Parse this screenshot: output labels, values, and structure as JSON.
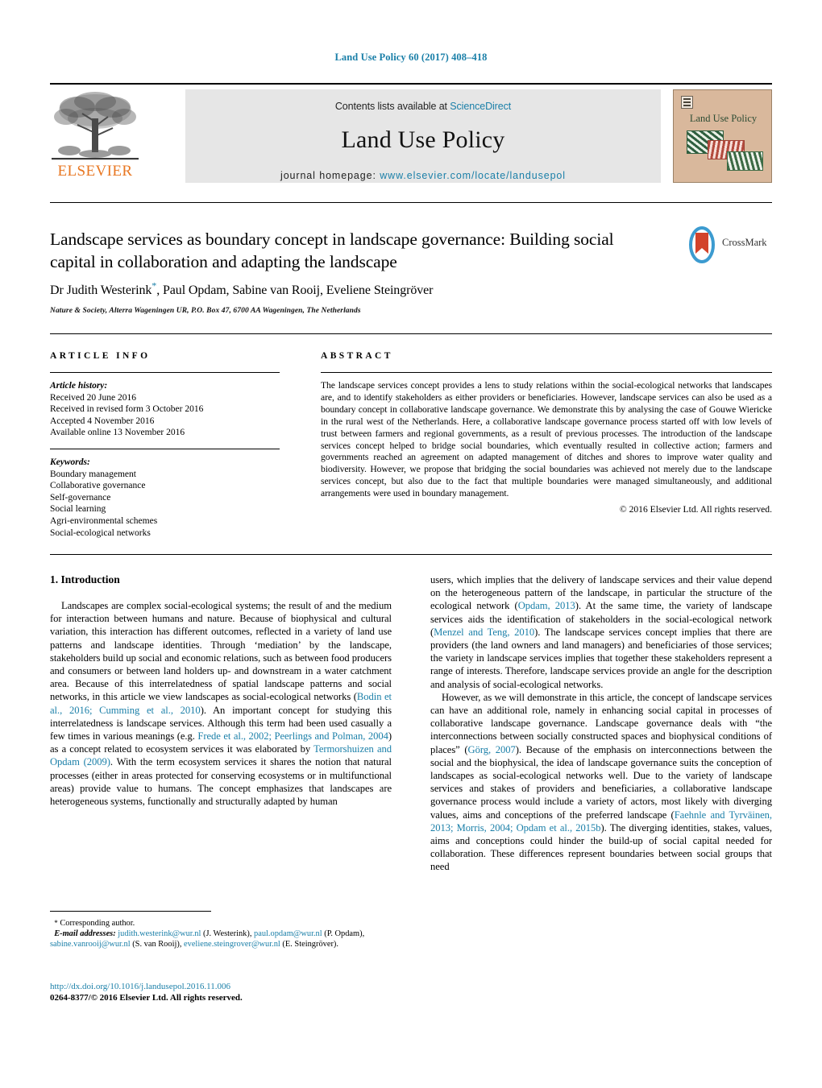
{
  "running_head": "Land Use Policy 60 (2017) 408–418",
  "masthead": {
    "contents_prefix": "Contents lists available at ",
    "sciencedirect": "ScienceDirect",
    "journal_title": "Land Use Policy",
    "homepage_prefix": "journal homepage: ",
    "homepage_url": "www.elsevier.com/locate/landusepol",
    "publisher_wordmark": "ELSEVIER",
    "cover_title": "Land Use Policy",
    "accent_color": "#1a7fa8",
    "elsevier_orange": "#E87722",
    "band_background": "#e6e6e6"
  },
  "article": {
    "title": "Landscape services as boundary concept in landscape governance: Building social capital in collaboration and adapting the landscape",
    "authors": "Dr Judith Westerink*, Paul Opdam, Sabine van Rooij, Eveliene Steingröver",
    "affiliation": "Nature & Society, Alterra Wageningen UR, P.O. Box 47, 6700 AA Wageningen, The Netherlands",
    "crossmark_label": "CrossMark"
  },
  "info": {
    "heading": "ARTICLE INFO",
    "history_label": "Article history:",
    "history": [
      "Received 20 June 2016",
      "Received in revised form 3 October 2016",
      "Accepted 4 November 2016",
      "Available online 13 November 2016"
    ],
    "keywords_label": "Keywords:",
    "keywords": [
      "Boundary management",
      "Collaborative governance",
      "Self-governance",
      "Social learning",
      "Agri-environmental schemes",
      "Social-ecological networks"
    ]
  },
  "abstract": {
    "heading": "ABSTRACT",
    "text": "The landscape services concept provides a lens to study relations within the social-ecological networks that landscapes are, and to identify stakeholders as either providers or beneficiaries. However, landscape services can also be used as a boundary concept in collaborative landscape governance. We demonstrate this by analysing the case of Gouwe Wiericke in the rural west of the Netherlands. Here, a collaborative landscape governance process started off with low levels of trust between farmers and regional governments, as a result of previous processes. The introduction of the landscape services concept helped to bridge social boundaries, which eventually resulted in collective action; farmers and governments reached an agreement on adapted management of ditches and shores to improve water quality and biodiversity. However, we propose that bridging the social boundaries was achieved not merely due to the landscape services concept, but also due to the fact that multiple boundaries were managed simultaneously, and additional arrangements were used in boundary management.",
    "copyright": "© 2016 Elsevier Ltd. All rights reserved."
  },
  "body": {
    "section_number_title": "1. Introduction",
    "left_paragraphs": [
      {
        "segments": [
          {
            "t": "Landscapes are complex social-ecological systems; the result of and the medium for interaction between humans and nature. Because of biophysical and cultural variation, this interaction has different outcomes, reflected in a variety of land use patterns and landscape identities. Through ‘mediation’ by the landscape, stakeholders build up social and economic relations, such as between food producers and consumers or between land holders up- and downstream in a water catchment area. Because of this interrelatedness of spatial landscape patterns and social networks, in this article we view landscapes as social-ecological networks (",
            "ref": false
          },
          {
            "t": "Bodin et al., 2016; Cumming et al., 2010",
            "ref": true
          },
          {
            "t": "). An important concept for studying this interrelatedness is landscape services. Although this term had been used casually a few times in various meanings (e.g. ",
            "ref": false
          },
          {
            "t": "Frede et al., 2002; Peerlings and Polman, 2004",
            "ref": true
          },
          {
            "t": ") as a concept related to ecosystem services it was elaborated by ",
            "ref": false
          },
          {
            "t": "Termorshuizen and Opdam (2009)",
            "ref": true
          },
          {
            "t": ". With the term ecosystem services it shares the notion that natural processes (either in areas protected for conserving ecosystems or in multifunctional areas) provide value to humans. The concept emphasizes that landscapes are heterogeneous systems, functionally and structurally adapted by human",
            "ref": false
          }
        ]
      }
    ],
    "right_paragraphs": [
      {
        "segments": [
          {
            "t": "users, which implies that the delivery of landscape services and their value depend on the heterogeneous pattern of the landscape, in particular the structure of the ecological network (",
            "ref": false
          },
          {
            "t": "Opdam, 2013",
            "ref": true
          },
          {
            "t": "). At the same time, the variety of landscape services aids the identification of stakeholders in the social-ecological network (",
            "ref": false
          },
          {
            "t": "Menzel and Teng, 2010",
            "ref": true
          },
          {
            "t": "). The landscape services concept implies that there are providers (the land owners and land managers) and beneficiaries of those services; the variety in landscape services implies that together these stakeholders represent a range of interests. Therefore, landscape services provide an angle for the description and analysis of social-ecological networks.",
            "ref": false
          }
        ]
      },
      {
        "segments": [
          {
            "t": "However, as we will demonstrate in this article, the concept of landscape services can have an additional role, namely in enhancing social capital in processes of collaborative landscape governance. Landscape governance deals with “the interconnections between socially constructed spaces and biophysical conditions of places” (",
            "ref": false
          },
          {
            "t": "Görg, 2007",
            "ref": true
          },
          {
            "t": "). Because of the emphasis on interconnections between the social and the biophysical, the idea of landscape governance suits the conception of landscapes as social-ecological networks well. Due to the variety of landscape services and stakes of providers and beneficiaries, a collaborative landscape governance process would include a variety of actors, most likely with diverging values, aims and conceptions of the preferred landscape (",
            "ref": false
          },
          {
            "t": "Faehnle and Tyrväinen, 2013; Morris, 2004; Opdam et al., 2015b",
            "ref": true
          },
          {
            "t": "). The diverging identities, stakes, values, aims and conceptions could hinder the build-up of social capital needed for collaboration. These differences represent boundaries between social groups that need",
            "ref": false
          }
        ]
      }
    ]
  },
  "footnotes": {
    "corresponding_star": "*",
    "corresponding_label": "Corresponding author.",
    "email_label": "E-mail addresses:",
    "emails": [
      {
        "address": "judith.westerink@wur.nl",
        "owner": "(J. Westerink)"
      },
      {
        "address": "paul.opdam@wur.nl",
        "owner": "(P. Opdam)"
      },
      {
        "address": "sabine.vanrooij@wur.nl",
        "owner": "(S. van Rooij)"
      },
      {
        "address": "eveliene.steingrover@wur.nl",
        "owner": "(E. Steingröver)"
      }
    ],
    "doi": "http://dx.doi.org/10.1016/j.landusepol.2016.11.006",
    "issn_line": "0264-8377/© 2016 Elsevier Ltd. All rights reserved."
  }
}
